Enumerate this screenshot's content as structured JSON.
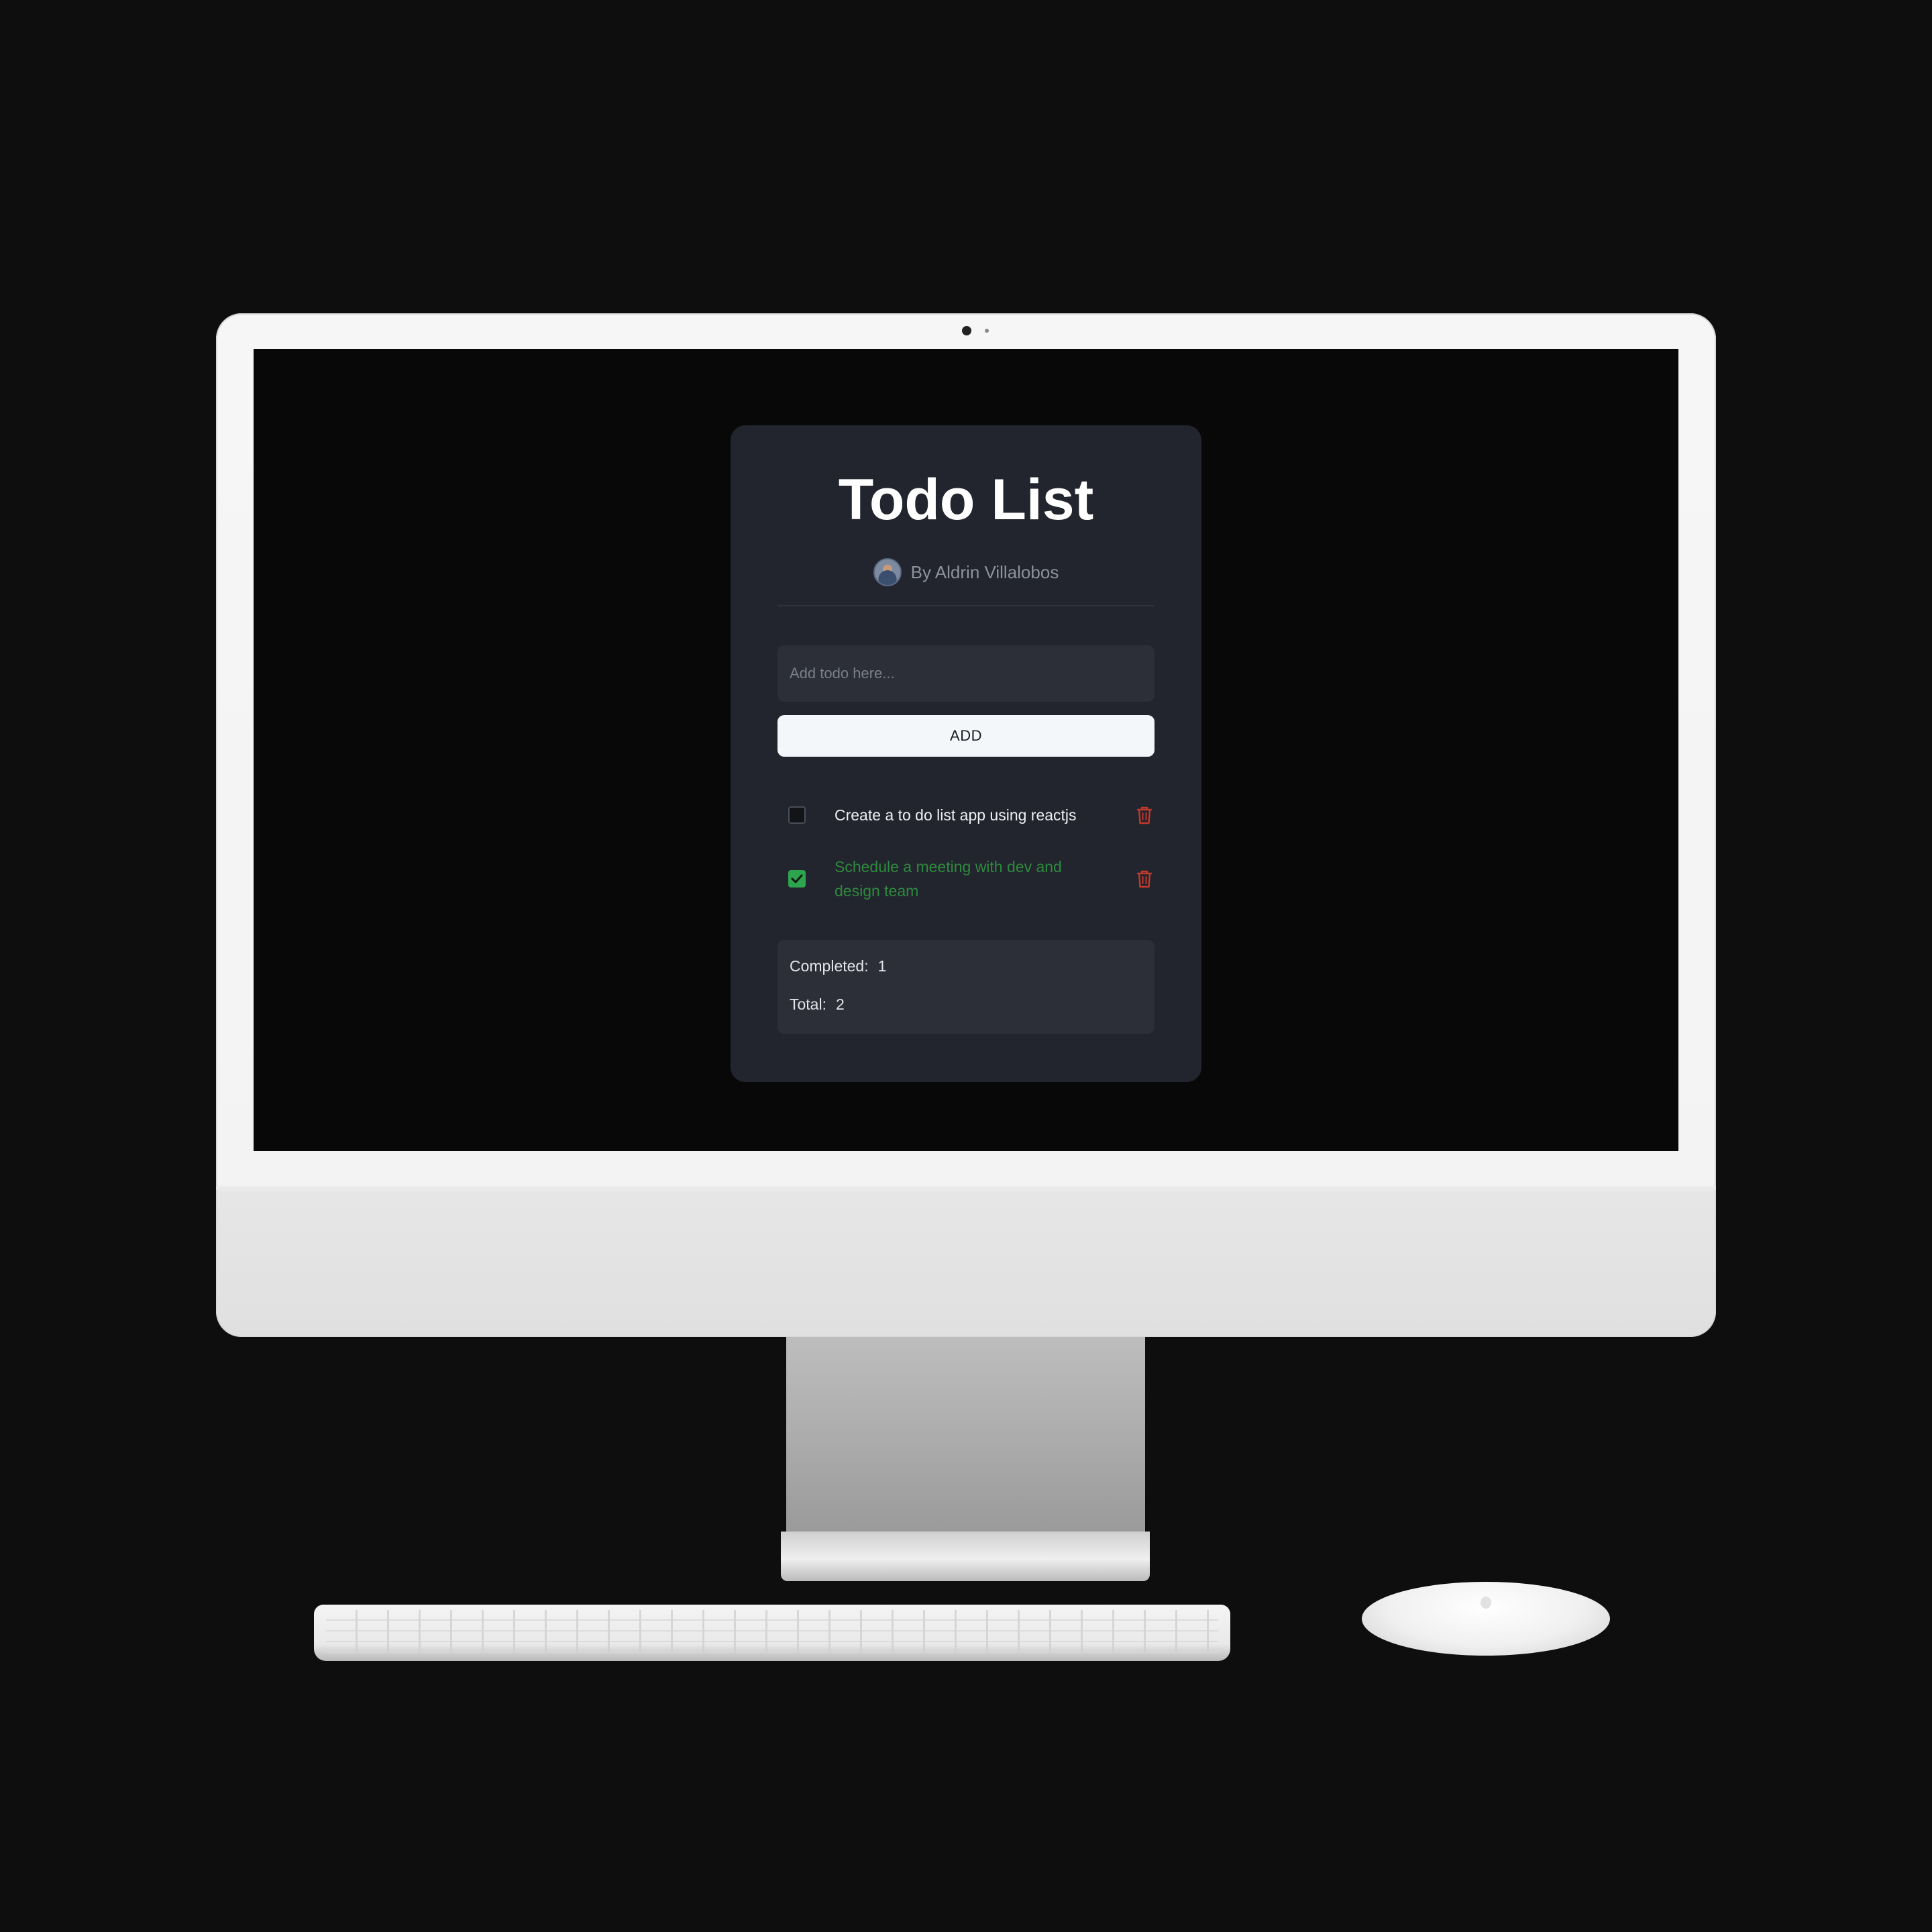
{
  "app": {
    "title": "Todo List",
    "author": "By Aldrin Villalobos"
  },
  "input": {
    "placeholder": "Add todo here...",
    "value": ""
  },
  "add_button": {
    "label": "ADD"
  },
  "todos": [
    {
      "text": "Create a to do list app using reactjs",
      "completed": false
    },
    {
      "text": "Schedule a meeting with dev and design team",
      "completed": true
    }
  ],
  "stats": {
    "completed_label": "Completed:",
    "completed_value": "1",
    "total_label": "Total:",
    "total_value": "2"
  },
  "colors": {
    "background": "#0e0e0e",
    "card": "#22252d",
    "completed_text": "#2e8a3e",
    "delete_icon": "#c0392b",
    "checkbox_checked": "#2da44e"
  },
  "icons": [
    "avatar",
    "checkbox-icon",
    "check-icon",
    "trash-icon"
  ]
}
